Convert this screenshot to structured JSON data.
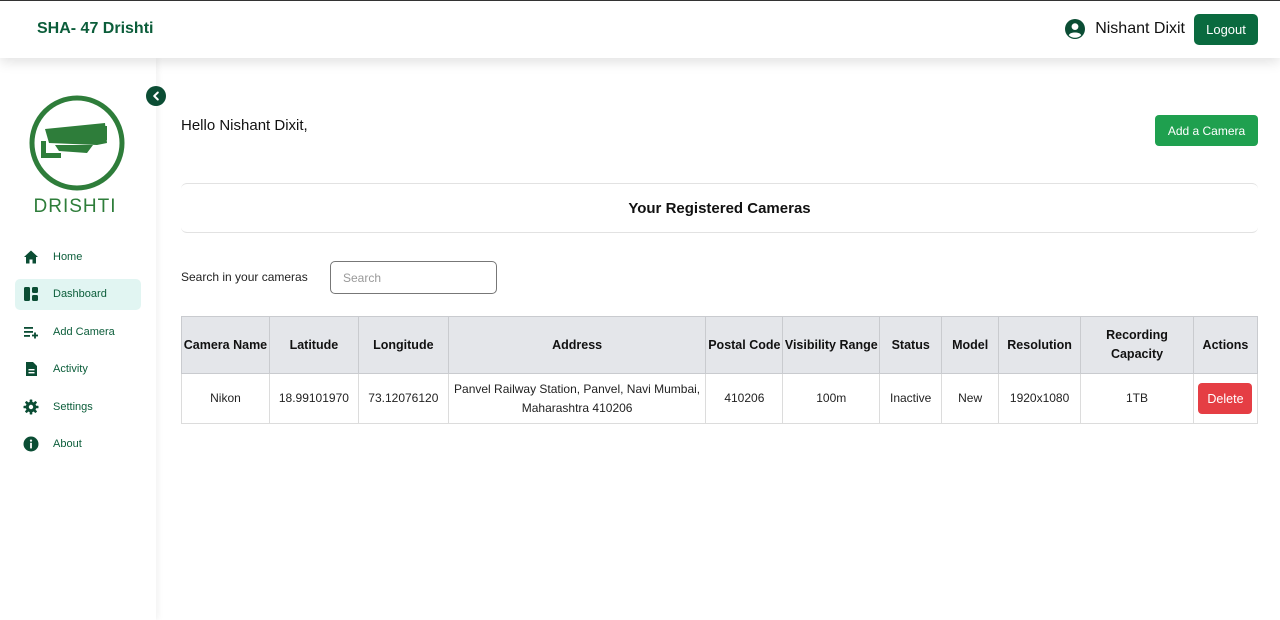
{
  "app": {
    "title": "SHA- 47 Drishti"
  },
  "user": {
    "name": "Nishant Dixit",
    "logout_label": "Logout"
  },
  "sidebar": {
    "logo_text": "DRISHTI",
    "items": [
      {
        "label": "Home",
        "icon": "home-icon"
      },
      {
        "label": "Dashboard",
        "icon": "dashboard-icon",
        "active": true
      },
      {
        "label": "Add Camera",
        "icon": "add-list-icon"
      },
      {
        "label": "Activity",
        "icon": "document-icon"
      },
      {
        "label": "Settings",
        "icon": "gear-icon"
      },
      {
        "label": "About",
        "icon": "info-icon"
      }
    ]
  },
  "main": {
    "greeting": "Hello Nishant Dixit,",
    "add_camera_label": "Add a Camera",
    "section_title": "Your Registered Cameras",
    "search": {
      "label": "Search in your cameras",
      "placeholder": "Search",
      "value": ""
    },
    "table": {
      "headers": [
        "Camera Name",
        "Latitude",
        "Longitude",
        "Address",
        "Postal Code",
        "Visibility Range",
        "Status",
        "Model",
        "Resolution",
        "Recording Capacity",
        "Actions"
      ],
      "rows": [
        {
          "camera_name": "Nikon",
          "latitude": "18.99101970",
          "longitude": "73.12076120",
          "address": "Panvel Railway Station, Panvel, Navi Mumbai, Maharashtra 410206",
          "postal_code": "410206",
          "visibility_range": "100m",
          "status": "Inactive",
          "model": "New",
          "resolution": "1920x1080",
          "recording_capacity": "1TB",
          "action_label": "Delete"
        }
      ]
    }
  },
  "colors": {
    "brand": "#0b5d3a",
    "primary_green": "#1fa04f",
    "logout_green": "#0a6a3f",
    "danger": "#e53e44",
    "active_nav_bg": "#e1f5f2"
  }
}
